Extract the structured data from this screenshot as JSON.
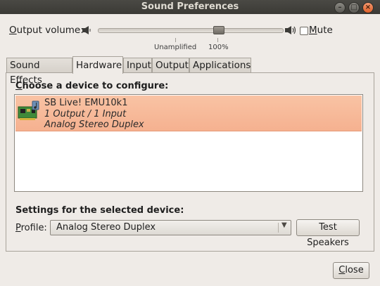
{
  "window": {
    "title": "Sound Preferences",
    "controls": {
      "minimize": "–",
      "maximize": "□",
      "close": "×"
    }
  },
  "volume": {
    "label_prefix": "O",
    "label_rest": "utput volume:",
    "level_percent": 66,
    "scale_unamplified": "Unamplified",
    "scale_100": "100%",
    "mute_label_prefix": "M",
    "mute_label_rest": "ute",
    "muted": false
  },
  "tabs": [
    {
      "label": "Sound Effects"
    },
    {
      "label": "Hardware",
      "active": true
    },
    {
      "label": "Input"
    },
    {
      "label": "Output"
    },
    {
      "label": "Applications"
    }
  ],
  "hardware": {
    "choose_prefix": "C",
    "choose_rest": "hoose a device to configure:",
    "device": {
      "name": "SB Live! EMU10k1",
      "io": "1 Output / 1 Input",
      "profile": "Analog Stereo Duplex",
      "selected": true,
      "icon": "sound-card-icon"
    },
    "settings_label": "Settings for the selected device:",
    "profile_prefix": "P",
    "profile_rest": "rofile:",
    "profile_value": "Analog Stereo Duplex",
    "test_button": "Test Speakers"
  },
  "footer": {
    "close_prefix": "C",
    "close_rest": "lose"
  },
  "colors": {
    "titlebar": "#3f3e3a",
    "selection": "#f5b190",
    "window_bg": "#efebe7"
  }
}
